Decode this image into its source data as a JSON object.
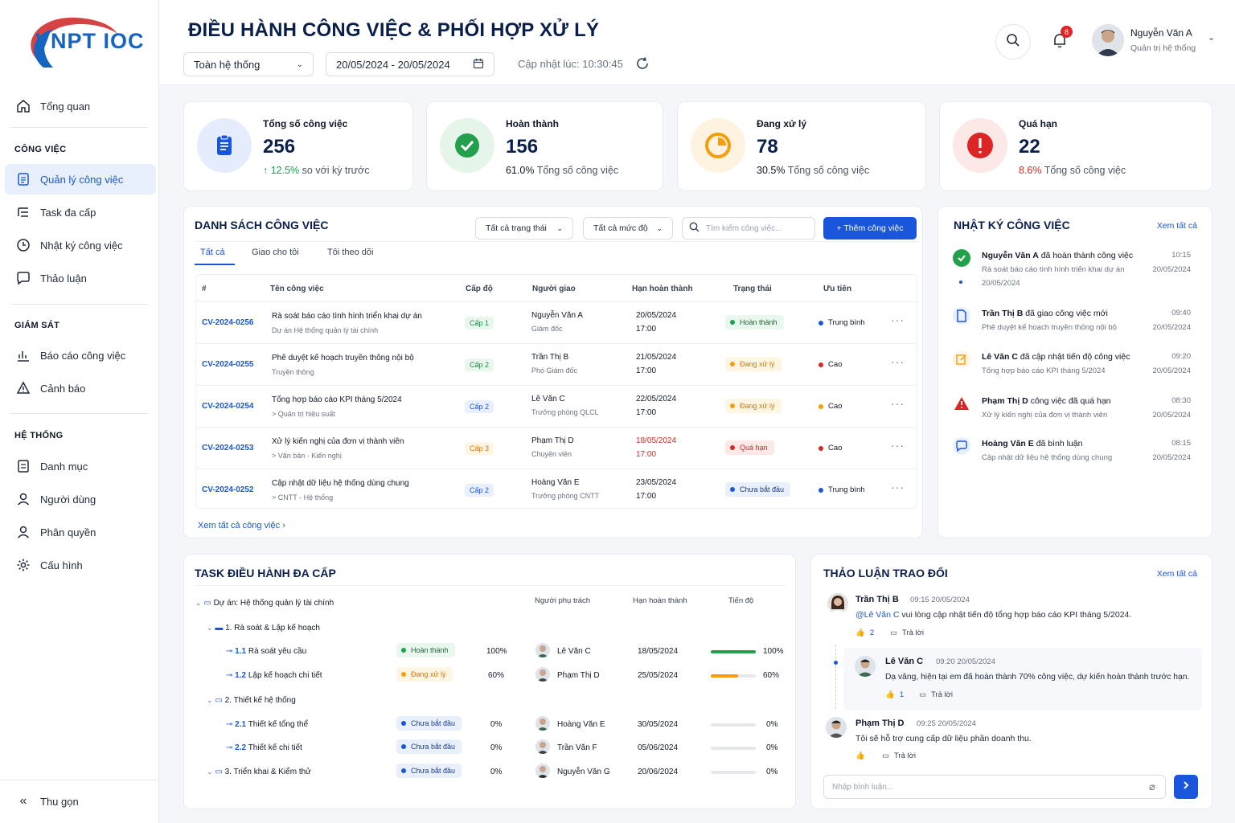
{
  "brand": {
    "logo_text": "VNPT IOC"
  },
  "sidebar": {
    "overview": "Tổng quan",
    "sections": [
      {
        "title": "CÔNG VIỆC",
        "items": [
          "Quản lý công việc",
          "Task đa cấp",
          "Nhật ký công việc",
          "Thảo luận"
        ]
      },
      {
        "title": "GIÁM SÁT",
        "items": [
          "Báo cáo công việc",
          "Cảnh báo"
        ]
      },
      {
        "title": "HỆ THỐNG",
        "items": [
          "Danh mục",
          "Người dùng",
          "Phân quyền",
          "Cấu hình"
        ]
      }
    ],
    "collapse": "Thu gọn"
  },
  "header": {
    "title": "ĐIỀU HÀNH CÔNG VIỆC & PHỐI HỢP XỬ LÝ",
    "scope": "Toàn hệ thống",
    "date_range": "20/05/2024 - 20/05/2024",
    "updated": "Cập nhật lúc: 10:30:45",
    "notifications": "8",
    "user_name": "Nguyễn Văn A",
    "user_role": "Quản trị hệ thống"
  },
  "stats": [
    {
      "label": "Tổng số công việc",
      "value": "256",
      "pct": "↑ 12.5%",
      "note": "so với kỳ trước",
      "color": "#1a56db"
    },
    {
      "label": "Hoàn thành",
      "value": "156",
      "pct": "61.0%",
      "note": "Tổng số công việc",
      "color": "#22a04b"
    },
    {
      "label": "Đang xử lý",
      "value": "78",
      "pct": "30.5%",
      "note": "Tổng số công việc",
      "color": "#f59e0b"
    },
    {
      "label": "Quá hạn",
      "value": "22",
      "pct": "8.6%",
      "note": "Tổng số công việc",
      "color": "#dc2626"
    }
  ],
  "tasks": {
    "title": "DANH SÁCH CÔNG VIỆC",
    "filter_status": "Tất cả trạng thái",
    "filter_level": "Tất cả mức độ",
    "search_placeholder": "Tìm kiếm công việc...",
    "add_button": "+ Thêm công việc",
    "tabs": [
      "Tất cả",
      "Giao cho tôi",
      "Tôi theo dõi"
    ],
    "columns": [
      "#",
      "Tên công việc",
      "Cấp độ",
      "Người giao",
      "Hạn hoàn thành",
      "Trạng thái",
      "Ưu tiên"
    ],
    "rows": [
      {
        "code": "CV-2024-0256",
        "name": "Rà soát báo cáo tình hình triển khai dự án",
        "project": "Dự án Hệ thống quản lý tài chính",
        "level": "Cấp 1",
        "assigner": "Nguyễn Văn A",
        "assigner_role": "Giám đốc",
        "due_date": "20/05/2024",
        "due_time": "17:00",
        "status": "Hoàn thành",
        "priority": "Trung bình"
      },
      {
        "code": "CV-2024-0255",
        "name": "Phê duyệt kế hoạch truyền thông nội bộ",
        "project": "Truyền thông",
        "level": "Cấp 2",
        "assigner": "Trần Thị B",
        "assigner_role": "Phó Giám đốc",
        "due_date": "21/05/2024",
        "due_time": "17:00",
        "status": "Đang xử lý",
        "priority": "Cao"
      },
      {
        "code": "CV-2024-0254",
        "name": "Tổng hợp báo cáo KPI tháng 5/2024",
        "project": "> Quản trị hiệu suất",
        "level": "Cấp 2",
        "assigner": "Lê Văn C",
        "assigner_role": "Trưởng phòng QLCL",
        "due_date": "22/05/2024",
        "due_time": "17:00",
        "status": "Đang xử lý",
        "priority": "Cao"
      },
      {
        "code": "CV-2024-0253",
        "name": "Xử lý kiến nghị của đơn vị thành viên",
        "project": "> Văn bản - Kiến nghị",
        "level": "Cấp 3",
        "assigner": "Phạm Thị D",
        "assigner_role": "Chuyên viên",
        "due_date": "18/05/2024",
        "due_time": "17:00",
        "status": "Quá hạn",
        "priority": "Cao"
      },
      {
        "code": "CV-2024-0252",
        "name": "Cập nhật dữ liệu hệ thống dùng chung",
        "project": "> CNTT - Hệ thống",
        "level": "Cấp 2",
        "assigner": "Hoàng Văn E",
        "assigner_role": "Trưởng phòng CNTT",
        "due_date": "23/05/2024",
        "due_time": "17:00",
        "status": "Chưa bắt đầu",
        "priority": "Trung bình"
      }
    ],
    "view_all": "Xem tất cả công việc"
  },
  "log": {
    "title": "NHẬT KÝ CÔNG VIỆC",
    "view_all": "Xem tất cả",
    "items": [
      {
        "actor": "Nguyễn Văn A",
        "action": "đã hoàn thành công việc",
        "detail": "Rà soát báo cáo tình hình triển khai dự án",
        "extra": "20/05/2024",
        "time": "10:15",
        "date": "20/05/2024"
      },
      {
        "actor": "Trần Thị B",
        "action": "đã giao công việc mới",
        "detail": "Phê duyệt kế hoạch truyền thông nội bộ",
        "time": "09:40",
        "date": "20/05/2024"
      },
      {
        "actor": "Lê Văn C",
        "action": "đã cập nhật tiến độ công việc",
        "detail": "Tổng hợp báo cáo KPI tháng 5/2024",
        "time": "09:20",
        "date": "20/05/2024"
      },
      {
        "actor": "Phạm Thị D",
        "action": "công việc đã quá hạn",
        "detail": "Xử lý kiến nghị của đơn vị thành viên",
        "time": "08:30",
        "date": "20/05/2024"
      },
      {
        "actor": "Hoàng Văn E",
        "action": "đã bình luận",
        "detail": "Cập nhật dữ liệu hệ thống dùng chung",
        "time": "08:15",
        "date": "20/05/2024"
      }
    ]
  },
  "tree": {
    "title": "TASK ĐIỀU HÀNH ĐA CẤP",
    "columns": [
      "Người phụ trách",
      "Hạn hoàn thành",
      "Tiến độ"
    ],
    "project": "Dự án: Hệ thống quản lý tài chính",
    "groups": [
      "1. Rà soát & Lập kế hoạch",
      "2. Thiết kế hệ thống",
      "3. Triển khai & Kiểm thử"
    ],
    "rows": [
      {
        "num": "1.1",
        "name": "Rà soát yêu cầu",
        "status": "Hoàn thành",
        "pct": "100%",
        "owner": "Lê Văn C",
        "due": "18/05/2024",
        "progress": 100
      },
      {
        "num": "1.2",
        "name": "Lập kế hoạch chi tiết",
        "status": "Đang xử lý",
        "pct": "60%",
        "owner": "Phạm Thị D",
        "due": "25/05/2024",
        "progress": 60
      },
      {
        "num": "2.1",
        "name": "Thiết kế tổng thể",
        "status": "Chưa bắt đầu",
        "pct": "0%",
        "owner": "Hoàng Văn E",
        "due": "30/05/2024",
        "progress": 0
      },
      {
        "num": "2.2",
        "name": "Thiết kế chi tiết",
        "status": "Chưa bắt đầu",
        "pct": "0%",
        "owner": "Trần Văn F",
        "due": "05/06/2024",
        "progress": 0
      },
      {
        "num": "",
        "name": "",
        "status": "Chưa bắt đầu",
        "pct": "0%",
        "owner": "Nguyễn Văn G",
        "due": "20/06/2024",
        "progress": 0
      }
    ]
  },
  "discussion": {
    "title": "THẢO LUẬN TRAO ĐỔI",
    "view_all": "Xem tất cả",
    "comments": [
      {
        "name": "Trần Thị B",
        "time": "09:15 20/05/2024",
        "mention": "@Lê Văn C",
        "text": "vui lòng cập nhật tiến độ tổng hợp báo cáo KPI tháng 5/2024.",
        "likes": "2",
        "reply": "Trả lời"
      },
      {
        "name": "Lê Văn C",
        "time": "09:20 20/05/2024",
        "text": "Dạ vâng, hiện tại em đã hoàn thành 70% công việc, dự kiến hoàn thành trước hạn.",
        "likes": "1",
        "reply": "Trả lời"
      },
      {
        "name": "Phạm Thị D",
        "time": "09:25 20/05/2024",
        "text": "Tôi sẽ hỗ trợ cung cấp dữ liệu phần doanh thu.",
        "likes": "",
        "reply": "Trả lời"
      }
    ],
    "input_placeholder": "Nhập bình luận..."
  }
}
